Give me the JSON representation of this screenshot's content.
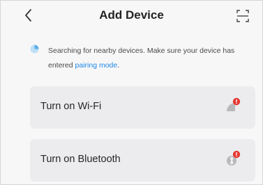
{
  "header": {
    "title": "Add Device",
    "back_icon": "chevron-left-icon",
    "scan_icon": "scan-frame-icon"
  },
  "notice": {
    "icon": "searching-indicator-icon",
    "text_before": "Searching for nearby devices. Make sure your device has entered ",
    "link_text": "pairing mode",
    "text_after": "."
  },
  "items": [
    {
      "label": "Turn on Wi-Fi",
      "icon": "wifi-off-alert-icon"
    },
    {
      "label": "Turn on Bluetooth",
      "icon": "bluetooth-off-alert-icon"
    }
  ],
  "colors": {
    "accent": "#1e88e5",
    "alert": "#e53935",
    "card_background": "#ececee",
    "page_background": "#f7f7f8"
  }
}
